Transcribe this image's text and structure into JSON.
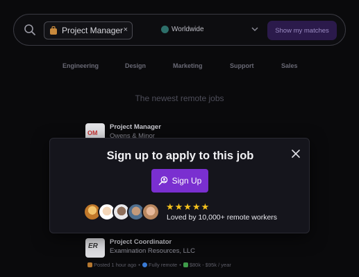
{
  "search": {
    "chip_label": "Project Manager",
    "chip_close": "×",
    "location_label": "Worldwide",
    "button_label": "Show my matches"
  },
  "categories": [
    "Engineering",
    "Design",
    "Marketing",
    "Support",
    "Sales"
  ],
  "section_title": "The newest remote jobs",
  "jobs": [
    {
      "title": "Project Manager",
      "company": "Owens & Minor",
      "logo": "OM"
    },
    {
      "title": "Project Coordinator",
      "company": "Examination Resources, LLC",
      "logo": "ER"
    }
  ],
  "job_meta": {
    "posted": "Posted 1 hour ago",
    "remote": "Fully remote",
    "salary": "$80k - $95k / year",
    "separator": "•"
  },
  "modal": {
    "title": "Sign up to apply to this job",
    "button_label": "Sign Up",
    "stars": "★★★★★",
    "loved_text": "Loved by 10,000+ remote workers"
  },
  "colors": {
    "accent": "#7a2fd0",
    "star": "#f6c21c",
    "background": "#0a0a0c"
  }
}
